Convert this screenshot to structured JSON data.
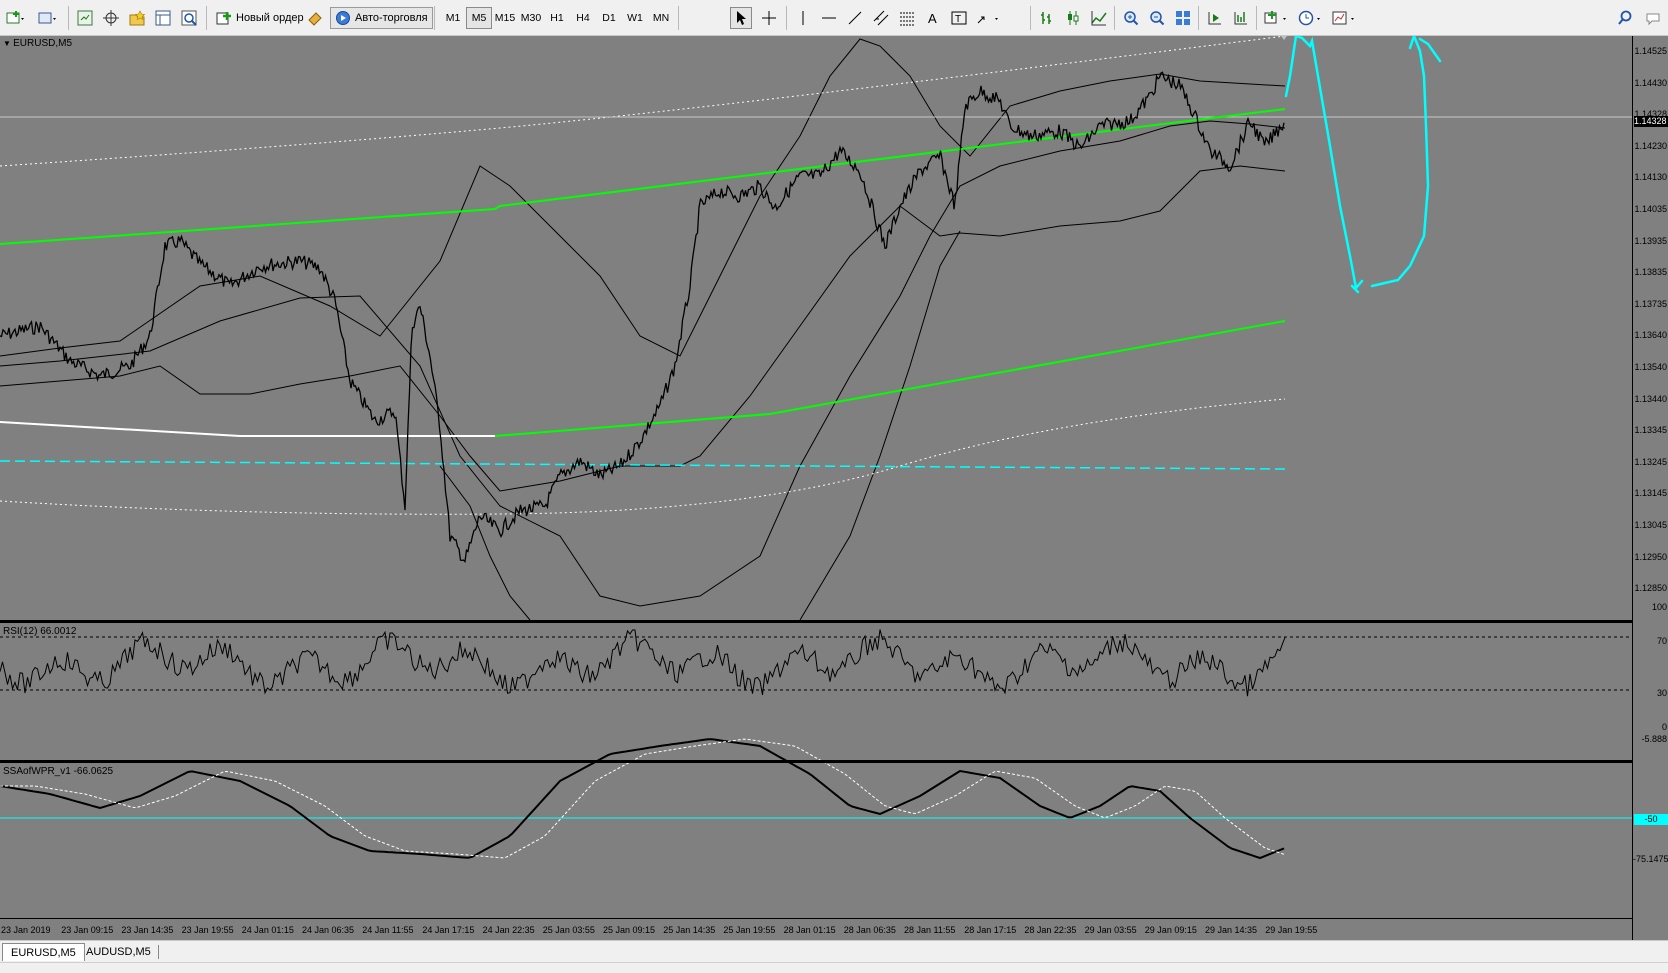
{
  "toolbar": {
    "new_order_label": "Новый ордер",
    "autotrading_label": "Авто-торговля",
    "timeframes": [
      "M1",
      "M5",
      "M15",
      "M30",
      "H1",
      "H4",
      "D1",
      "W1",
      "MN"
    ],
    "active_timeframe": "M5"
  },
  "chart": {
    "symbol_label": "EURUSD,M5",
    "rsi_label": "RSI(12) 66.0012",
    "ssa_label": "SSAofWPR_v1 -66.0625",
    "price_axis_ticks": [
      "1.14525",
      "1.14430",
      "1.14328",
      "1.14230",
      "1.14130",
      "1.14035",
      "1.13935",
      "1.13835",
      "1.13735",
      "1.13640",
      "1.13540",
      "1.13440",
      "1.13345",
      "1.13245",
      "1.13145",
      "1.13045",
      "1.12950",
      "1.12850"
    ],
    "current_price": "1.14328",
    "rsi_axis_ticks": [
      "100",
      "70",
      "30",
      "0"
    ],
    "ssa_axis_ticks": [
      "-5.888",
      "-75.1475"
    ],
    "ssa_level_tag": "-50",
    "time_axis_ticks": [
      "23 Jan 2019",
      "23 Jan 09:15",
      "23 Jan 14:35",
      "23 Jan 19:55",
      "24 Jan 01:15",
      "24 Jan 06:35",
      "24 Jan 11:55",
      "24 Jan 17:15",
      "24 Jan 22:35",
      "25 Jan 03:55",
      "25 Jan 09:15",
      "25 Jan 14:35",
      "25 Jan 19:55",
      "28 Jan 01:15",
      "28 Jan 06:35",
      "28 Jan 11:55",
      "28 Jan 17:15",
      "28 Jan 22:35",
      "29 Jan 03:55",
      "29 Jan 09:15",
      "29 Jan 14:35",
      "29 Jan 19:55"
    ],
    "colors": {
      "background": "#808080",
      "regression_channel": "#00ff00",
      "annotation": "#00ffff",
      "horizontal_line": "#00ffff"
    }
  },
  "tabs": [
    {
      "label": "EURUSD,M5",
      "active": true
    },
    {
      "label": "AUDUSD,M5",
      "active": false
    }
  ]
}
